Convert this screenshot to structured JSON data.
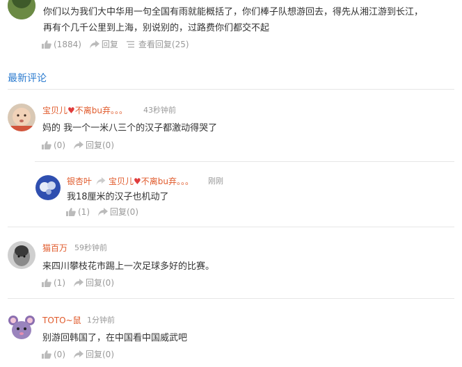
{
  "top_comment": {
    "line1": "你们以为我们大中华用一句全国有雨就能概括了，你们棒子队想游回去，得先从湘江游到长江，",
    "line2": "再有个几千公里到上海，别说别的，过路费你们都交不起",
    "likes": "(1884)",
    "reply_label": "回复",
    "view_replies": "查看回复(25)"
  },
  "section_title": "最新评论",
  "comments": [
    {
      "username": "宝贝儿",
      "username_suffix": "不离bu弃。。。",
      "time": "43秒钟前",
      "text": "妈的 我一个一米八三个的汉子都激动得哭了",
      "likes": "(0)",
      "reply": "回复(0)"
    },
    {
      "username": "猫百万",
      "time": "59秒钟前",
      "text": "来四川攀枝花市踢上一次足球多好的比赛。",
      "likes": "(1)",
      "reply": "回复(0)"
    },
    {
      "username": "TOTO~鼠",
      "time": "1分钟前",
      "text": "别游回韩国了，在中国看中国威武吧",
      "likes": "(0)",
      "reply": "回复(0)"
    }
  ],
  "nested_reply": {
    "username": "银杏叶",
    "reply_to": "宝贝儿",
    "reply_to_suffix": "不离bu弃。。。",
    "time": "刚刚",
    "text": "我18厘米的汉子也机动了",
    "likes": "(1)",
    "reply": "回复(0)"
  },
  "colors": {
    "link_blue": "#2b7bcf",
    "username_orange": "#e05a2b",
    "heart_red": "#e03c3c",
    "muted": "#999999"
  },
  "icons": {
    "like": "thumbs-up-icon",
    "reply": "reply-arrow-icon",
    "list": "list-icon",
    "heart": "heart-icon"
  }
}
